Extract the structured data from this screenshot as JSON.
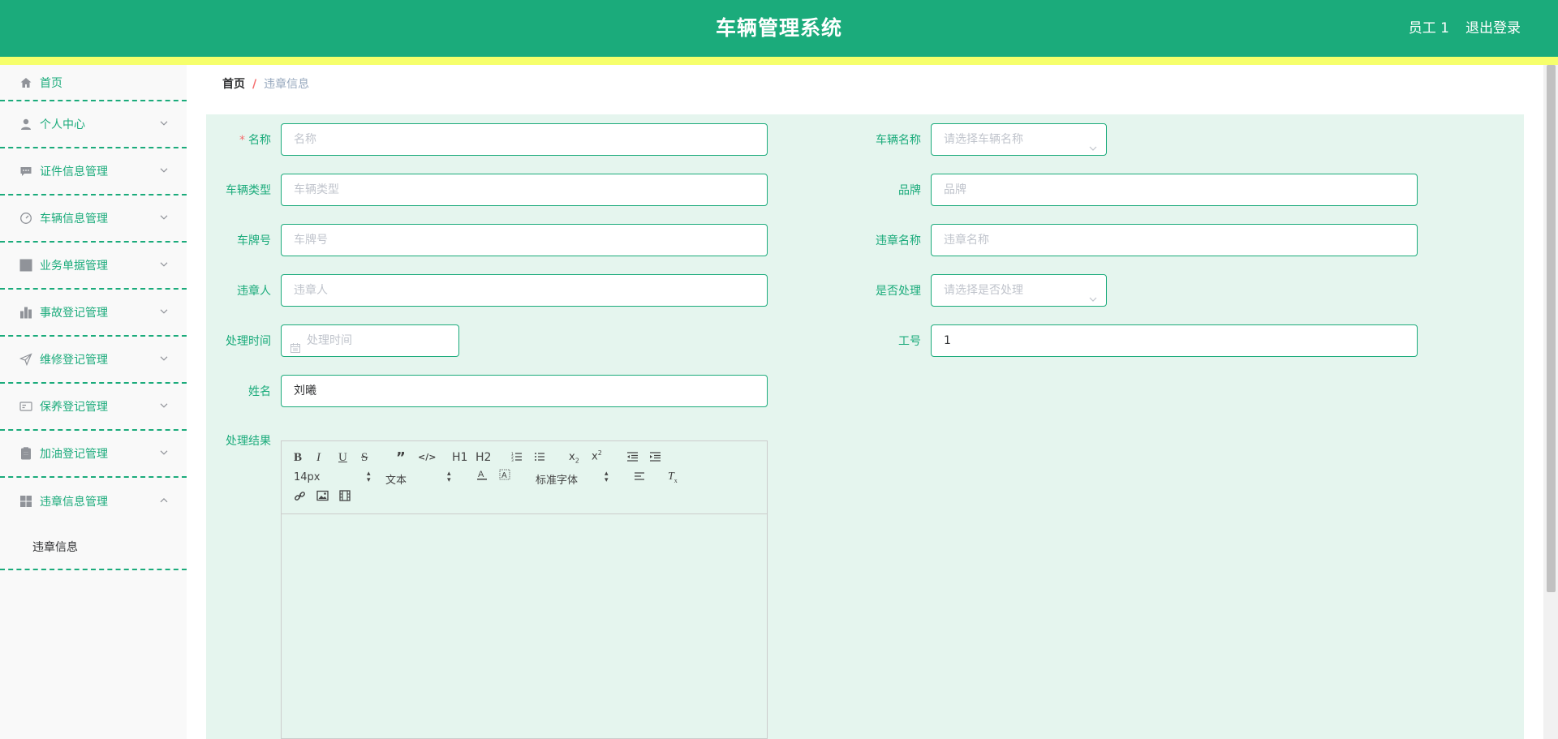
{
  "header": {
    "title": "车辆管理系统",
    "user": "员工 1",
    "logout": "退出登录"
  },
  "sidebar": {
    "items": [
      {
        "label": "首页",
        "icon": "home-icon"
      },
      {
        "label": "个人中心",
        "icon": "user-icon"
      },
      {
        "label": "证件信息管理",
        "icon": "message-icon"
      },
      {
        "label": "车辆信息管理",
        "icon": "gauge-icon"
      },
      {
        "label": "业务单据管理",
        "icon": "grid-icon"
      },
      {
        "label": "事故登记管理",
        "icon": "bar-chart-icon"
      },
      {
        "label": "维修登记管理",
        "icon": "send-icon"
      },
      {
        "label": "保养登记管理",
        "icon": "card-icon"
      },
      {
        "label": "加油登记管理",
        "icon": "clipboard-icon"
      },
      {
        "label": "违章信息管理",
        "icon": "menu-icon"
      }
    ],
    "subitem": "违章信息"
  },
  "breadcrumb": {
    "home": "首页",
    "separator": "/",
    "current": "违章信息"
  },
  "form": {
    "name": {
      "label": "名称",
      "placeholder": "名称"
    },
    "vehicle_name": {
      "label": "车辆名称",
      "placeholder": "请选择车辆名称"
    },
    "vehicle_type": {
      "label": "车辆类型",
      "placeholder": "车辆类型"
    },
    "brand": {
      "label": "品牌",
      "placeholder": "品牌"
    },
    "plate": {
      "label": "车牌号",
      "placeholder": "车牌号"
    },
    "violation_name": {
      "label": "违章名称",
      "placeholder": "违章名称"
    },
    "violator": {
      "label": "违章人",
      "placeholder": "违章人"
    },
    "handled": {
      "label": "是否处理",
      "placeholder": "请选择是否处理"
    },
    "handle_time": {
      "label": "处理时间",
      "placeholder": "处理时间"
    },
    "job_no": {
      "label": "工号",
      "value": "1"
    },
    "person_name": {
      "label": "姓名",
      "value": "刘曦"
    },
    "result": {
      "label": "处理结果"
    }
  },
  "editor": {
    "font_size": "14px",
    "block": "文本",
    "font": "标准字体",
    "h1": "H1",
    "h2": "H2"
  },
  "colors": {
    "primary": "#1bab7b",
    "yellow": "#f6ff6b",
    "form_bg": "#e5f5ee",
    "required": "#f56c6c"
  }
}
